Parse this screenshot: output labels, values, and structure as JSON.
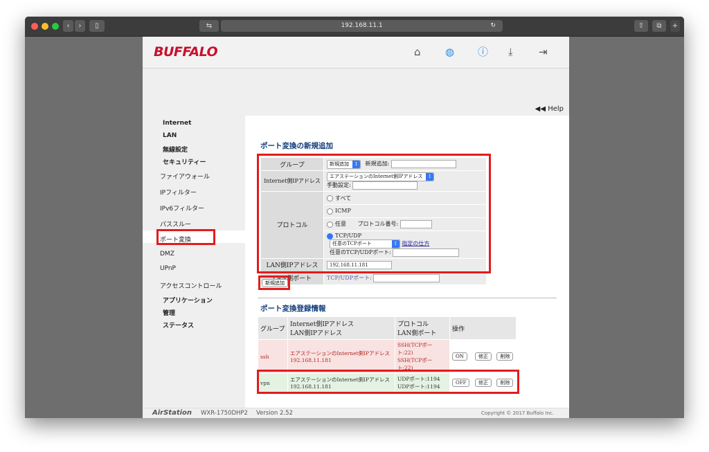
{
  "browser": {
    "url": "192.168.11.1",
    "colors": {
      "close": "#fe5f57",
      "minimize": "#febc2e",
      "zoom": "#28c840"
    }
  },
  "header": {
    "logo": "BUFFALO",
    "icons": [
      "home-icon",
      "globe-icon",
      "info-icon",
      "download-icon",
      "logout-icon"
    ]
  },
  "help_link": "◀◀ Help",
  "nav": {
    "items": [
      {
        "label": "Internet",
        "type": "top"
      },
      {
        "label": "LAN",
        "type": "top"
      },
      {
        "label": "無線設定",
        "type": "top"
      },
      {
        "label": "セキュリティー",
        "type": "top"
      },
      {
        "label": "ファイアウォール",
        "type": "sub"
      },
      {
        "label": "IPフィルター",
        "type": "sub"
      },
      {
        "label": "IPv6フィルター",
        "type": "sub"
      },
      {
        "label": "パススルー",
        "type": "sub"
      },
      {
        "label": "ポート変換",
        "type": "sub",
        "active": true
      },
      {
        "label": "DMZ",
        "type": "sub"
      },
      {
        "label": "UPnP",
        "type": "sub"
      },
      {
        "label": "アクセスコントロール",
        "type": "sub"
      },
      {
        "label": "アプリケーション",
        "type": "top"
      },
      {
        "label": "管理",
        "type": "top"
      },
      {
        "label": "ステータス",
        "type": "top"
      }
    ]
  },
  "new_entry": {
    "title": "ポート変換の新規追加",
    "group_label": "グループ",
    "group_select": "新規追加",
    "group_new_label": "新規追加:",
    "ip_label": "Internet側IPアドレス",
    "ip_select": "エアステーションのInternet側IPアドレス",
    "ip_manual_label": "手動設定:",
    "protocol_label": "プロトコル",
    "proto_all": "すべて",
    "proto_icmp": "ICMP",
    "proto_any": "任意",
    "proto_number_label": "プロトコル番号:",
    "proto_tcpudp": "TCP/UDP",
    "tcp_port_select": "任意のTCPポート",
    "howto_link": "指定の仕方",
    "any_tcpudp_port_label": "任意のTCP/UDPポート:",
    "lan_ip_label": "LAN側IPアドレス",
    "lan_ip_value": "192.168.11.181",
    "lan_port_label": "LAN側ポート",
    "lan_port_field_label": "TCP/UDPポート:",
    "add_button": "新規追加"
  },
  "registered": {
    "title": "ポート変換登録情報",
    "headers": {
      "group": "グループ",
      "ip_line1": "Internet側IPアドレス",
      "ip_line2": "LAN側IPアドレス",
      "proto_line1": "プロトコル",
      "proto_line2": "LAN側ポート",
      "ops": "操作"
    },
    "rows": [
      {
        "group": "ssh",
        "ip1": "エアステーションのInternet側IPアドレス",
        "ip2": "192.168.11.181",
        "proto1": "SSH(TCPポート:22)",
        "proto2": "SSH(TCPポート:22)",
        "toggle": "ON",
        "edit": "修正",
        "delete": "削除",
        "color": "#b3261e",
        "bg": "#f8e2e2"
      },
      {
        "group": "vpn",
        "ip1": "エアステーションのInternet側IPアドレス",
        "ip2": "192.168.11.181",
        "proto1": "UDPポート:1194",
        "proto2": "UDPポート:1194",
        "toggle": "OFF",
        "edit": "修正",
        "delete": "削除",
        "color": "#333333",
        "bg": "#e4f2e1"
      }
    ]
  },
  "footer": {
    "brand": "AirStation",
    "model": "WXR-1750DHP2",
    "version": "Version 2.52",
    "copyright": "Copyright © 2017 Buffalo Inc."
  },
  "highlight_color": "#e11c1c"
}
